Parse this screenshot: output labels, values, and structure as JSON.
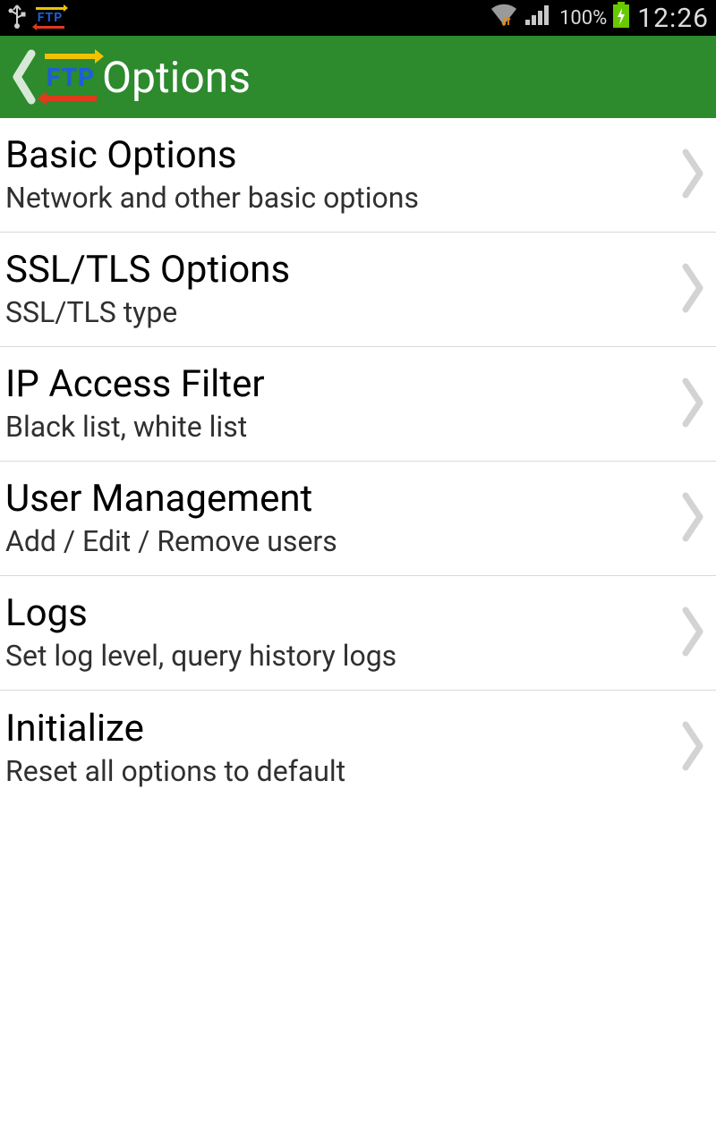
{
  "status_bar": {
    "battery_pct": "100%",
    "clock": "12:26"
  },
  "app_bar": {
    "logo_text": "FTP",
    "title": "Options"
  },
  "options": [
    {
      "title": "Basic Options",
      "sub": "Network and other basic options"
    },
    {
      "title": "SSL/TLS Options",
      "sub": "SSL/TLS type"
    },
    {
      "title": "IP Access Filter",
      "sub": "Black list, white list"
    },
    {
      "title": "User Management",
      "sub": "Add / Edit / Remove users"
    },
    {
      "title": "Logs",
      "sub": "Set log level, query history logs"
    },
    {
      "title": "Initialize",
      "sub": "Reset all options to default"
    }
  ]
}
